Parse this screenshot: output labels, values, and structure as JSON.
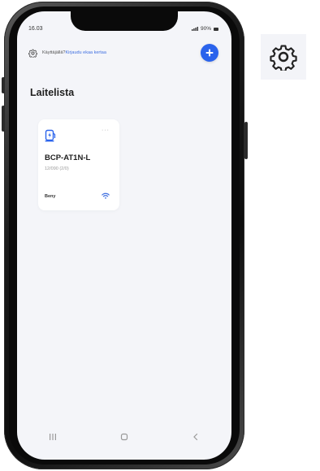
{
  "status_bar": {
    "time": "16.03",
    "battery": "90%"
  },
  "topbar": {
    "hint_text": "Käyttäjällä?",
    "hint_link": "Kirjaudu ekaa kertaa"
  },
  "page_title": "Laitelista",
  "devices": [
    {
      "name": "BCP-AT1N-L",
      "subtitle": "12/090 (2/0)",
      "owner": "Beny",
      "more_label": "···"
    }
  ],
  "icons": {
    "settings": "gear-icon",
    "add": "plus-icon",
    "charger": "ev-charger-icon",
    "wifi": "wifi-icon",
    "nav_recent": "recent-apps-icon",
    "nav_home": "home-icon",
    "nav_back": "back-icon"
  },
  "colors": {
    "accent": "#2a63ec",
    "link": "#3f6fe0",
    "background": "#f4f5f9"
  }
}
